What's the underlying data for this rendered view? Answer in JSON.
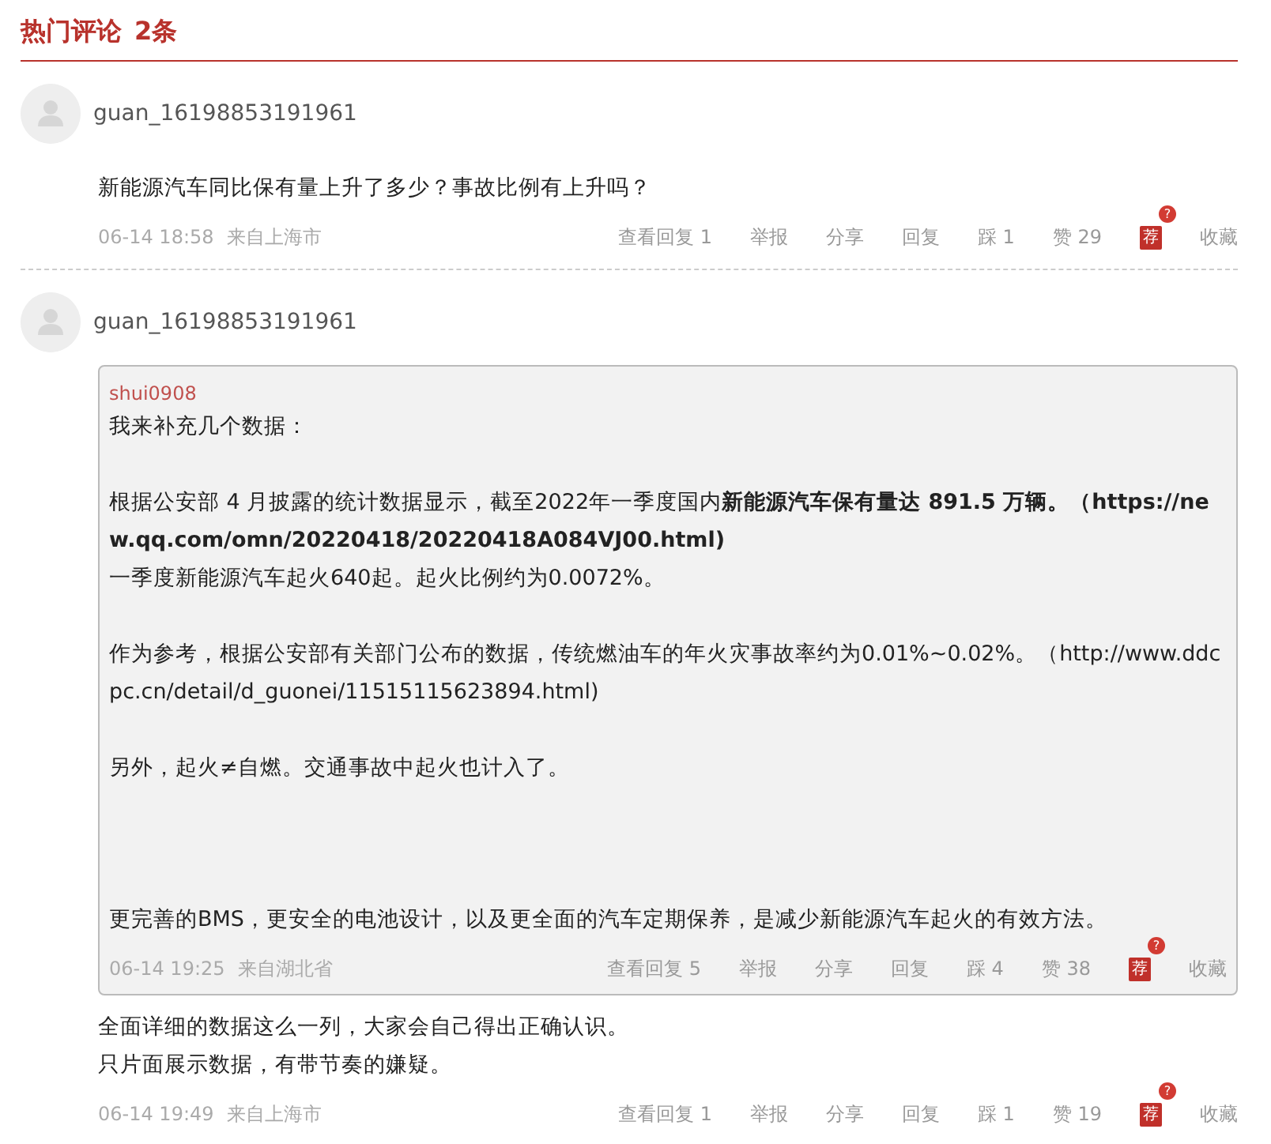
{
  "header": {
    "title": "热门评论",
    "count": "2条"
  },
  "comments": [
    {
      "user": "guan_16198853191961",
      "lines": [
        "新能源汽车同比保有量上升了多少？事故比例有上升吗？"
      ],
      "time": "06-14 18:58",
      "location": "来自上海市",
      "actions": [
        {
          "kind": "text",
          "label": "查看回复 1"
        },
        {
          "kind": "text",
          "label": "举报"
        },
        {
          "kind": "text",
          "label": "分享"
        },
        {
          "kind": "text",
          "label": "回复"
        },
        {
          "kind": "text",
          "label": "踩 1"
        },
        {
          "kind": "text",
          "label": "赞 29"
        },
        {
          "kind": "recommend",
          "label": "荐",
          "badge": "?"
        },
        {
          "kind": "text",
          "label": "收藏"
        }
      ]
    },
    {
      "user": "guan_16198853191961",
      "quote": {
        "user": "shui0908",
        "paragraphs": [
          "我来补充几个数据：",
          "根据公安部 4 月披露的统计数据显示，截至2022年一季度国内**新能源汽车保有量达 891.5 万辆。（https://new.qq.com/omn/20220418/20220418A084VJ00.html)**\n一季度新能源汽车起火640起。起火比例约为0.0072%。",
          "作为参考，根据公安部有关部门公布的数据，传统燃油车的年火灾事故率约为0.01%~0.02%。（http://www.ddcpc.cn/detail/d_guonei/11515115623894.html)",
          "另外，起火≠自燃。交通事故中起火也计入了。",
          "更完善的BMS，更安全的电池设计，以及更全面的汽车定期保养，是减少新能源汽车起火的有效方法。"
        ],
        "time": "06-14 19:25",
        "location": "来自湖北省",
        "actions": [
          {
            "kind": "text",
            "label": "查看回复 5"
          },
          {
            "kind": "text",
            "label": "举报"
          },
          {
            "kind": "text",
            "label": "分享"
          },
          {
            "kind": "text",
            "label": "回复"
          },
          {
            "kind": "text",
            "label": "踩 4"
          },
          {
            "kind": "text",
            "label": "赞 38"
          },
          {
            "kind": "recommend",
            "label": "荐",
            "badge": "?"
          },
          {
            "kind": "text",
            "label": "收藏"
          }
        ]
      },
      "lines": [
        "全面详细的数据这么一列，大家会自己得出正确认识。",
        "只片面展示数据，有带节奏的嫌疑。"
      ],
      "time": "06-14 19:49",
      "location": "来自上海市",
      "actions": [
        {
          "kind": "text",
          "label": "查看回复 1"
        },
        {
          "kind": "text",
          "label": "举报"
        },
        {
          "kind": "text",
          "label": "分享"
        },
        {
          "kind": "text",
          "label": "回复"
        },
        {
          "kind": "text",
          "label": "踩 1"
        },
        {
          "kind": "text",
          "label": "赞 19"
        },
        {
          "kind": "recommend",
          "label": "荐",
          "badge": "?"
        },
        {
          "kind": "text",
          "label": "收藏"
        }
      ]
    }
  ]
}
